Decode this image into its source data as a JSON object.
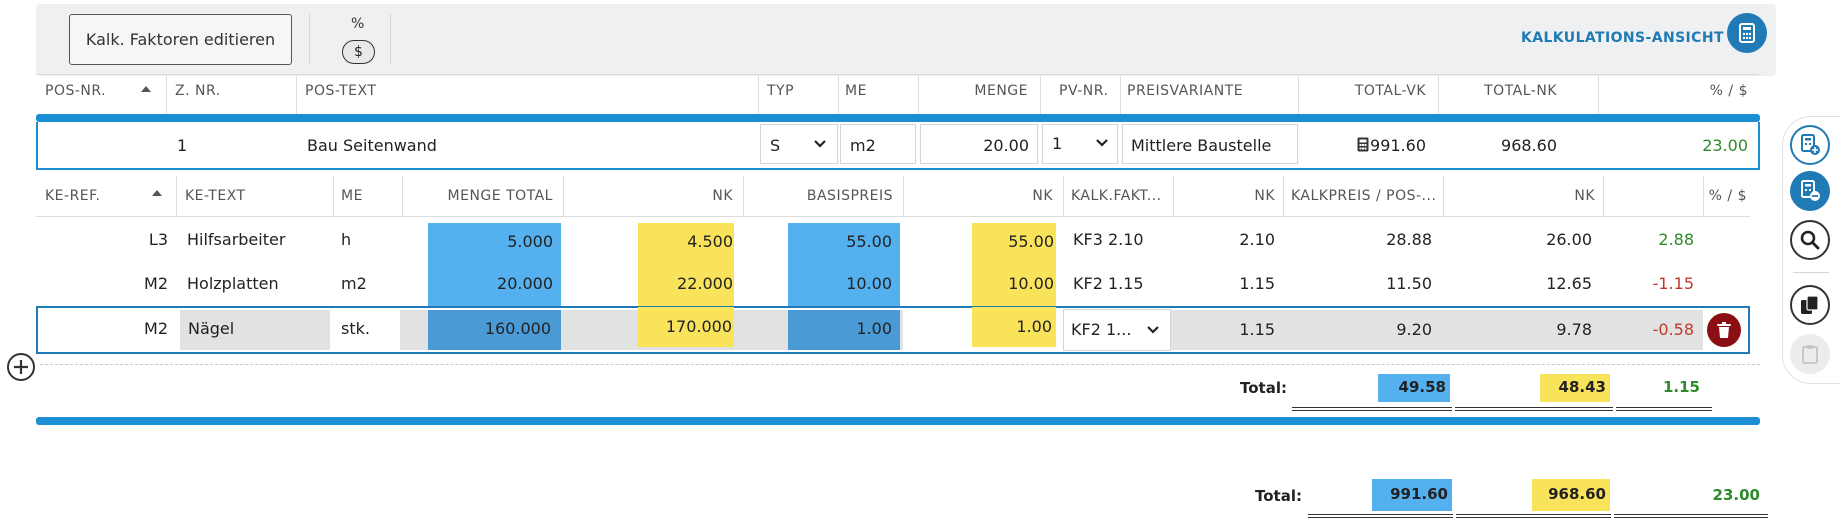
{
  "toolbar": {
    "edit_button_label": "Kalk. Faktoren editieren",
    "percent_label": "%",
    "dollar_label": "$",
    "view_label": "KALKULATIONS-ANSICHT"
  },
  "position_table": {
    "headers": [
      "POS-NR.",
      "Z. NR.",
      "POS-TEXT",
      "TYP",
      "ME",
      "MENGE",
      "PV-NR.",
      "PREISVARIANTE",
      "TOTAL-VK",
      "TOTAL-NK",
      "% / $"
    ],
    "row": {
      "z_nr": "1",
      "pos_text": "Bau Seitenwand",
      "typ": "S",
      "me": "m2",
      "menge": "20.00",
      "pv_nr": "1",
      "preisvariante": "Mittlere Baustelle",
      "total_vk": "991.60",
      "total_nk": "968.60",
      "pct": "23.00"
    }
  },
  "ke_table": {
    "headers": [
      "KE-REF.",
      "KE-TEXT",
      "ME",
      "MENGE TOTAL",
      "NK",
      "BASISPREIS",
      "NK",
      "KALK.FAKT...",
      "NK",
      "KALKPREIS / POS-...",
      "NK",
      "% / $"
    ],
    "rows": [
      {
        "ref": "L3",
        "text": "Hilfsarbeiter",
        "me": "h",
        "menge_total": "5.000",
        "nk1": "4.500",
        "basispreis": "55.00",
        "nk2": "55.00",
        "kalk_fakt": "KF3 2.10",
        "nk3": "2.10",
        "kalkpreis": "28.88",
        "nk4": "26.00",
        "pct": "2.88"
      },
      {
        "ref": "M2",
        "text": "Holzplatten",
        "me": "m2",
        "menge_total": "20.000",
        "nk1": "22.000",
        "basispreis": "10.00",
        "nk2": "10.00",
        "kalk_fakt": "KF2 1.15",
        "nk3": "1.15",
        "kalkpreis": "11.50",
        "nk4": "12.65",
        "pct": "-1.15"
      },
      {
        "ref": "M2",
        "text": "Nägel",
        "me": "stk.",
        "menge_total": "160.000",
        "nk1": "170.000",
        "basispreis": "1.00",
        "nk2": "1.00",
        "kalk_fakt": "KF2 1...",
        "nk3": "1.15",
        "kalkpreis": "9.20",
        "nk4": "9.78",
        "pct": "-0.58"
      }
    ],
    "total_label": "Total:",
    "total_vk": "49.58",
    "total_nk": "48.43",
    "total_pct": "1.15"
  },
  "grand_total": {
    "label": "Total:",
    "vk": "991.60",
    "nk": "968.60",
    "pct": "23.00"
  },
  "colors": {
    "accent": "#1b8ed4",
    "blue_cell": "#55b0ef",
    "yellow_cell": "#f8e35a",
    "positive": "#2e8a2a",
    "negative": "#c0392b",
    "delete": "#8b0f14"
  },
  "icons": [
    "calculator-icon",
    "sort-up-icon",
    "chevron-down-icon",
    "plus-circle-icon",
    "trash-icon",
    "calculator-add-icon",
    "calculator-remove-icon",
    "search-icon",
    "copy-icon",
    "paste-icon"
  ]
}
